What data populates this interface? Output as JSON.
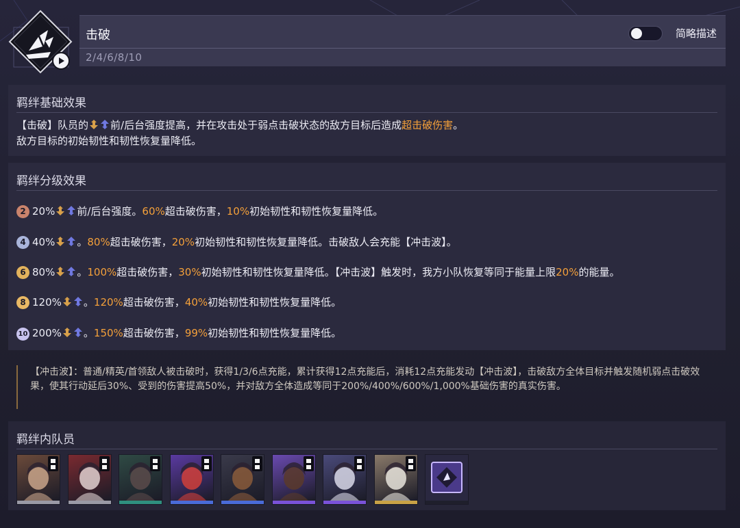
{
  "header": {
    "title": "击破",
    "levels": "2/4/6/8/10",
    "toggle_label": "简略描述",
    "toggle_on": false
  },
  "base_section": {
    "title": "羁绊基础效果",
    "line1": {
      "prefix": "【击破】队员的",
      "icon_names": [
        "front-role-icon",
        "back-role-icon"
      ],
      "middle": "前/后台强度提高，并在攻击处于弱点击破状态的敌方目标后造成",
      "highlight": "超击破伤害",
      "suffix": "。"
    },
    "line2": "敌方目标的初始韧性和韧性恢复量降低。"
  },
  "tier_section": {
    "title": "羁绊分级效果",
    "tiers": [
      {
        "level": "2",
        "badge_color": "#c9836c",
        "pct": "20%",
        "after_icons": "前/后台强度。",
        "parts": [
          {
            "t": "60%",
            "h": true
          },
          {
            "t": "超击破伤害，",
            "h": false
          },
          {
            "t": "10%",
            "h": true
          },
          {
            "t": "初始韧性和韧性恢复量降低。",
            "h": false
          }
        ]
      },
      {
        "level": "4",
        "badge_color": "#a9b4da",
        "pct": "40%",
        "after_icons": "。",
        "parts": [
          {
            "t": "80%",
            "h": true
          },
          {
            "t": "超击破伤害，",
            "h": false
          },
          {
            "t": "20%",
            "h": true
          },
          {
            "t": "初始韧性和韧性恢复量降低。击破敌人会充能【冲击波】。",
            "h": false
          }
        ]
      },
      {
        "level": "6",
        "badge_color": "#e2b25c",
        "pct": "80%",
        "after_icons": "。",
        "parts": [
          {
            "t": "100%",
            "h": true
          },
          {
            "t": "超击破伤害，",
            "h": false
          },
          {
            "t": "30%",
            "h": true
          },
          {
            "t": "初始韧性和韧性恢复量降低。【冲击波】触发时，我方小队恢复等同于能量上限",
            "h": false
          },
          {
            "t": "20%",
            "h": true
          },
          {
            "t": "的能量。",
            "h": false
          }
        ]
      },
      {
        "level": "8",
        "badge_color": "#e8b864",
        "pct": "120%",
        "after_icons": "。",
        "parts": [
          {
            "t": "120%",
            "h": true
          },
          {
            "t": "超击破伤害，",
            "h": false
          },
          {
            "t": "40%",
            "h": true
          },
          {
            "t": "初始韧性和韧性恢复量降低。",
            "h": false
          }
        ]
      },
      {
        "level": "10",
        "badge_color": "#c8c3ee",
        "pct": "200%",
        "after_icons": "。",
        "parts": [
          {
            "t": "150%",
            "h": true
          },
          {
            "t": "超击破伤害，",
            "h": false
          },
          {
            "t": "99%",
            "h": true
          },
          {
            "t": "初始韧性和韧性恢复量降低。",
            "h": false
          }
        ]
      }
    ]
  },
  "note": "【冲击波】：普通/精英/首领敌人被击破时，获得1/3/6点充能，累计获得12点充能后，消耗12点充能发动【冲击波】，击破敌方全体目标并触发随机弱点击破效果，使其行动延后30%、受到的伤害提高50%，并对敌方全体造成等同于200%/400%/600%/1,000%基础伤害的真实伤害。",
  "members_section": {
    "title": "羁绊内队员",
    "members": [
      {
        "name": "member-1",
        "bar_color": "#9a9aa6",
        "bg": "#6b4a3a",
        "accent": "#c9a58a"
      },
      {
        "name": "member-2",
        "bar_color": "#9a9aa6",
        "bg": "#7a2a30",
        "accent": "#e0d0d0"
      },
      {
        "name": "member-3",
        "bar_color": "#2f8f7f",
        "bg": "#2f4a44",
        "accent": "#5a4a4a"
      },
      {
        "name": "member-4",
        "bar_color": "#4a6bd8",
        "bg": "#5a3aa0",
        "accent": "#d0403a"
      },
      {
        "name": "member-5",
        "bar_color": "#4a6bd8",
        "bg": "#3a3a4a",
        "accent": "#8a5a3a"
      },
      {
        "name": "member-6",
        "bar_color": "#7a52d8",
        "bg": "#6a4ab0",
        "accent": "#5a3a2a"
      },
      {
        "name": "member-7",
        "bar_color": "#7a52d8",
        "bg": "#4a4a7a",
        "accent": "#d8d8e8"
      },
      {
        "name": "member-8",
        "bar_color": "#c9a246",
        "bg": "#8a7a6a",
        "accent": "#e8e4dc"
      },
      {
        "name": "member-9-emblem",
        "bar_color": "#1f1f2c",
        "bg": "#2a2840",
        "accent": "#8a6ad8"
      }
    ]
  },
  "colors": {
    "accent_highlight": "#f4a03a",
    "front_icon": "#d8a04a",
    "back_icon": "#6f78e0"
  }
}
